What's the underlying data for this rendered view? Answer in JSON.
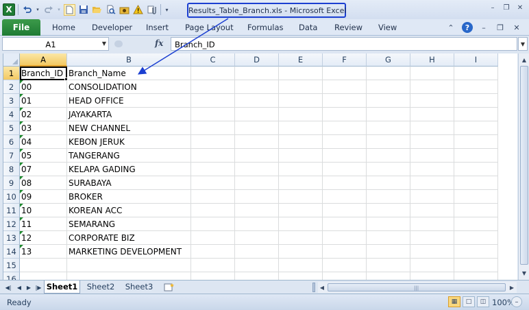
{
  "window": {
    "title": "Results_Table_Branch.xls  -  Microsoft Excel",
    "app_icon": "X",
    "controls": [
      "minimize-icon",
      "restore-icon",
      "close-icon"
    ]
  },
  "quick_access": [
    "undo-icon",
    "redo-icon",
    "new-icon",
    "save-icon",
    "open-icon",
    "print-preview-icon",
    "screenshot-icon",
    "warning-icon",
    "attach-icon",
    "customize-icon"
  ],
  "ribbon": {
    "file_label": "File",
    "tabs": [
      "Home",
      "Developer",
      "Insert",
      "Page Layout",
      "Formulas",
      "Data",
      "Review",
      "View"
    ]
  },
  "formula_bar": {
    "name_box": "A1",
    "fx_label": "fx",
    "content": "Branch_ID"
  },
  "sheet": {
    "columns": [
      "A",
      "B",
      "C",
      "D",
      "E",
      "F",
      "G",
      "H",
      "I"
    ],
    "rows": [
      {
        "num": "1",
        "a": "Branch_ID",
        "b": "Branch_Name"
      },
      {
        "num": "2",
        "a": "00",
        "b": "CONSOLIDATION"
      },
      {
        "num": "3",
        "a": "01",
        "b": "HEAD OFFICE"
      },
      {
        "num": "4",
        "a": "02",
        "b": "JAYAKARTA"
      },
      {
        "num": "5",
        "a": "03",
        "b": "NEW CHANNEL"
      },
      {
        "num": "6",
        "a": "04",
        "b": "KEBON JERUK"
      },
      {
        "num": "7",
        "a": "05",
        "b": "TANGERANG"
      },
      {
        "num": "8",
        "a": "07",
        "b": "KELAPA GADING"
      },
      {
        "num": "9",
        "a": "08",
        "b": "SURABAYA"
      },
      {
        "num": "10",
        "a": "09",
        "b": "BROKER"
      },
      {
        "num": "11",
        "a": "10",
        "b": "KOREAN ACC"
      },
      {
        "num": "12",
        "a": "11",
        "b": "SEMARANG"
      },
      {
        "num": "13",
        "a": "12",
        "b": "CORPORATE BIZ"
      },
      {
        "num": "14",
        "a": "13",
        "b": "MARKETING DEVELOPMENT"
      },
      {
        "num": "15",
        "a": "",
        "b": ""
      },
      {
        "num": "16",
        "a": "",
        "b": ""
      }
    ]
  },
  "sheet_tabs": [
    "Sheet1",
    "Sheet2",
    "Sheet3"
  ],
  "status": {
    "ready": "Ready",
    "zoom": "100%"
  },
  "colors": {
    "excel_green": "#1e7b34",
    "annotation_blue": "#1b3fd1",
    "selection_header": "#f3c963",
    "text_number_marker": "#1e8a2e"
  }
}
